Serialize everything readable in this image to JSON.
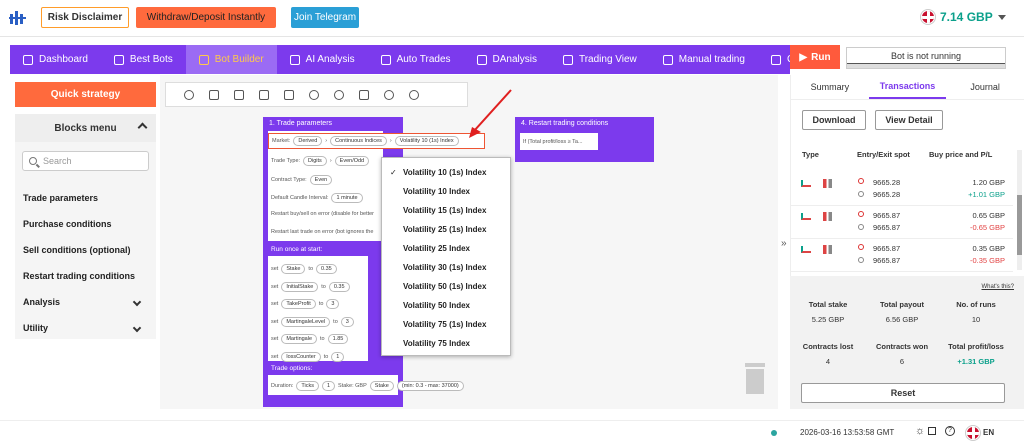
{
  "header": {
    "risk_label": "Risk Disclaimer",
    "withdraw_label": "Withdraw/Deposit Instantly",
    "telegram_label": "Join Telegram",
    "balance": "7.14 GBP"
  },
  "nav": {
    "items": [
      {
        "label": "Dashboard",
        "icon": "grid-icon"
      },
      {
        "label": "Best Bots",
        "icon": "bot-icon"
      },
      {
        "label": "Bot Builder",
        "icon": "puzzle-icon"
      },
      {
        "label": "AI Analysis",
        "icon": "chart-icon"
      },
      {
        "label": "Auto Trades",
        "icon": "refresh-icon"
      },
      {
        "label": "DAnalysis",
        "icon": "chart-icon"
      },
      {
        "label": "Trading View",
        "icon": "chart-icon"
      },
      {
        "label": "Manual trading",
        "icon": "chart-icon"
      },
      {
        "label": "C",
        "icon": "chart-icon"
      }
    ],
    "active": "Bot Builder",
    "run_label": "Run",
    "status": "Bot is not running"
  },
  "left": {
    "quick_strategy": "Quick strategy",
    "blocks_title": "Blocks menu",
    "search_placeholder": "Search",
    "items": [
      "Trade parameters",
      "Purchase conditions",
      "Sell conditions (optional)",
      "Restart trading conditions"
    ],
    "expandable": [
      "Analysis",
      "Utility"
    ]
  },
  "workspace": {
    "trade_block_title": "1. Trade parameters",
    "market_label": "Market:",
    "market_values": [
      "Derived",
      "Continuous Indices",
      "Volatility 10 (1s) Index"
    ],
    "trade_type_label": "Trade Type:",
    "trade_type_values": [
      "Digits",
      "Even/Odd"
    ],
    "contract_type_label": "Contract Type:",
    "contract_type_value": "Even",
    "candle_label": "Default Candle Interval:",
    "candle_value": "1 minute",
    "restart_error": "Restart buy/sell on error (disable for better",
    "restart_last": "Restart last trade on error (bot ignores the",
    "run_once": "Run once at start:",
    "set_label": "set",
    "to_label": "to",
    "vars": [
      {
        "name": "Stake",
        "value": "0.35"
      },
      {
        "name": "InitialStake",
        "value": "0.35"
      },
      {
        "name": "TakeProfit",
        "value": "3"
      },
      {
        "name": "MartingaleLevel",
        "value": "3"
      },
      {
        "name": "Martingale",
        "value": "1.85"
      },
      {
        "name": "lossCounter",
        "value": "1"
      }
    ],
    "trade_options": "Trade options:",
    "duration_label": "Duration:",
    "duration_unit": "Ticks",
    "duration_value": "1",
    "stake_label": "Stake: GBP",
    "stake_select": "Stake",
    "stake_range": "(min: 0.3 - max: 37000)",
    "restart_block_title": "4. Restart trading conditions",
    "restart_condition": "If (Total profit/loss ≥ Ta..."
  },
  "dropdown": {
    "options": [
      "Volatility 10 (1s) Index",
      "Volatility 10 Index",
      "Volatility 15 (1s) Index",
      "Volatility 25 (1s) Index",
      "Volatility 25 Index",
      "Volatility 30 (1s) Index",
      "Volatility 50 (1s) Index",
      "Volatility 50 Index",
      "Volatility 75 (1s) Index",
      "Volatility 75 Index"
    ],
    "selected": "Volatility 10 (1s) Index"
  },
  "right": {
    "tabs": [
      "Summary",
      "Transactions",
      "Journal"
    ],
    "active_tab": "Transactions",
    "download": "Download",
    "view_detail": "View Detail",
    "col_type": "Type",
    "col_spot": "Entry/Exit spot",
    "col_price": "Buy price and P/L",
    "transactions": [
      {
        "entry": "9665.28",
        "exit": "9665.28",
        "buy": "1.20 GBP",
        "pl": "+1.01 GBP"
      },
      {
        "entry": "9665.87",
        "exit": "9665.87",
        "buy": "0.65 GBP",
        "pl": "-0.65 GBP"
      },
      {
        "entry": "9665.87",
        "exit": "9665.87",
        "buy": "0.35 GBP",
        "pl": "-0.35 GBP"
      }
    ],
    "whats_this": "What's this?",
    "stats": {
      "total_stake_label": "Total stake",
      "total_stake": "5.25 GBP",
      "total_payout_label": "Total payout",
      "total_payout": "6.56 GBP",
      "runs_label": "No. of runs",
      "runs": "10",
      "lost_label": "Contracts lost",
      "lost": "4",
      "won_label": "Contracts won",
      "won": "6",
      "pl_label": "Total profit/loss",
      "pl": "+1.31 GBP"
    },
    "reset": "Reset"
  },
  "footer": {
    "timestamp": "2026-03-16 13:53:58 GMT",
    "language": "EN"
  },
  "colors": {
    "primary": "#7c3aed",
    "accent": "#ff6a3d",
    "profit": "#0ba08b",
    "loss": "#e24444"
  }
}
